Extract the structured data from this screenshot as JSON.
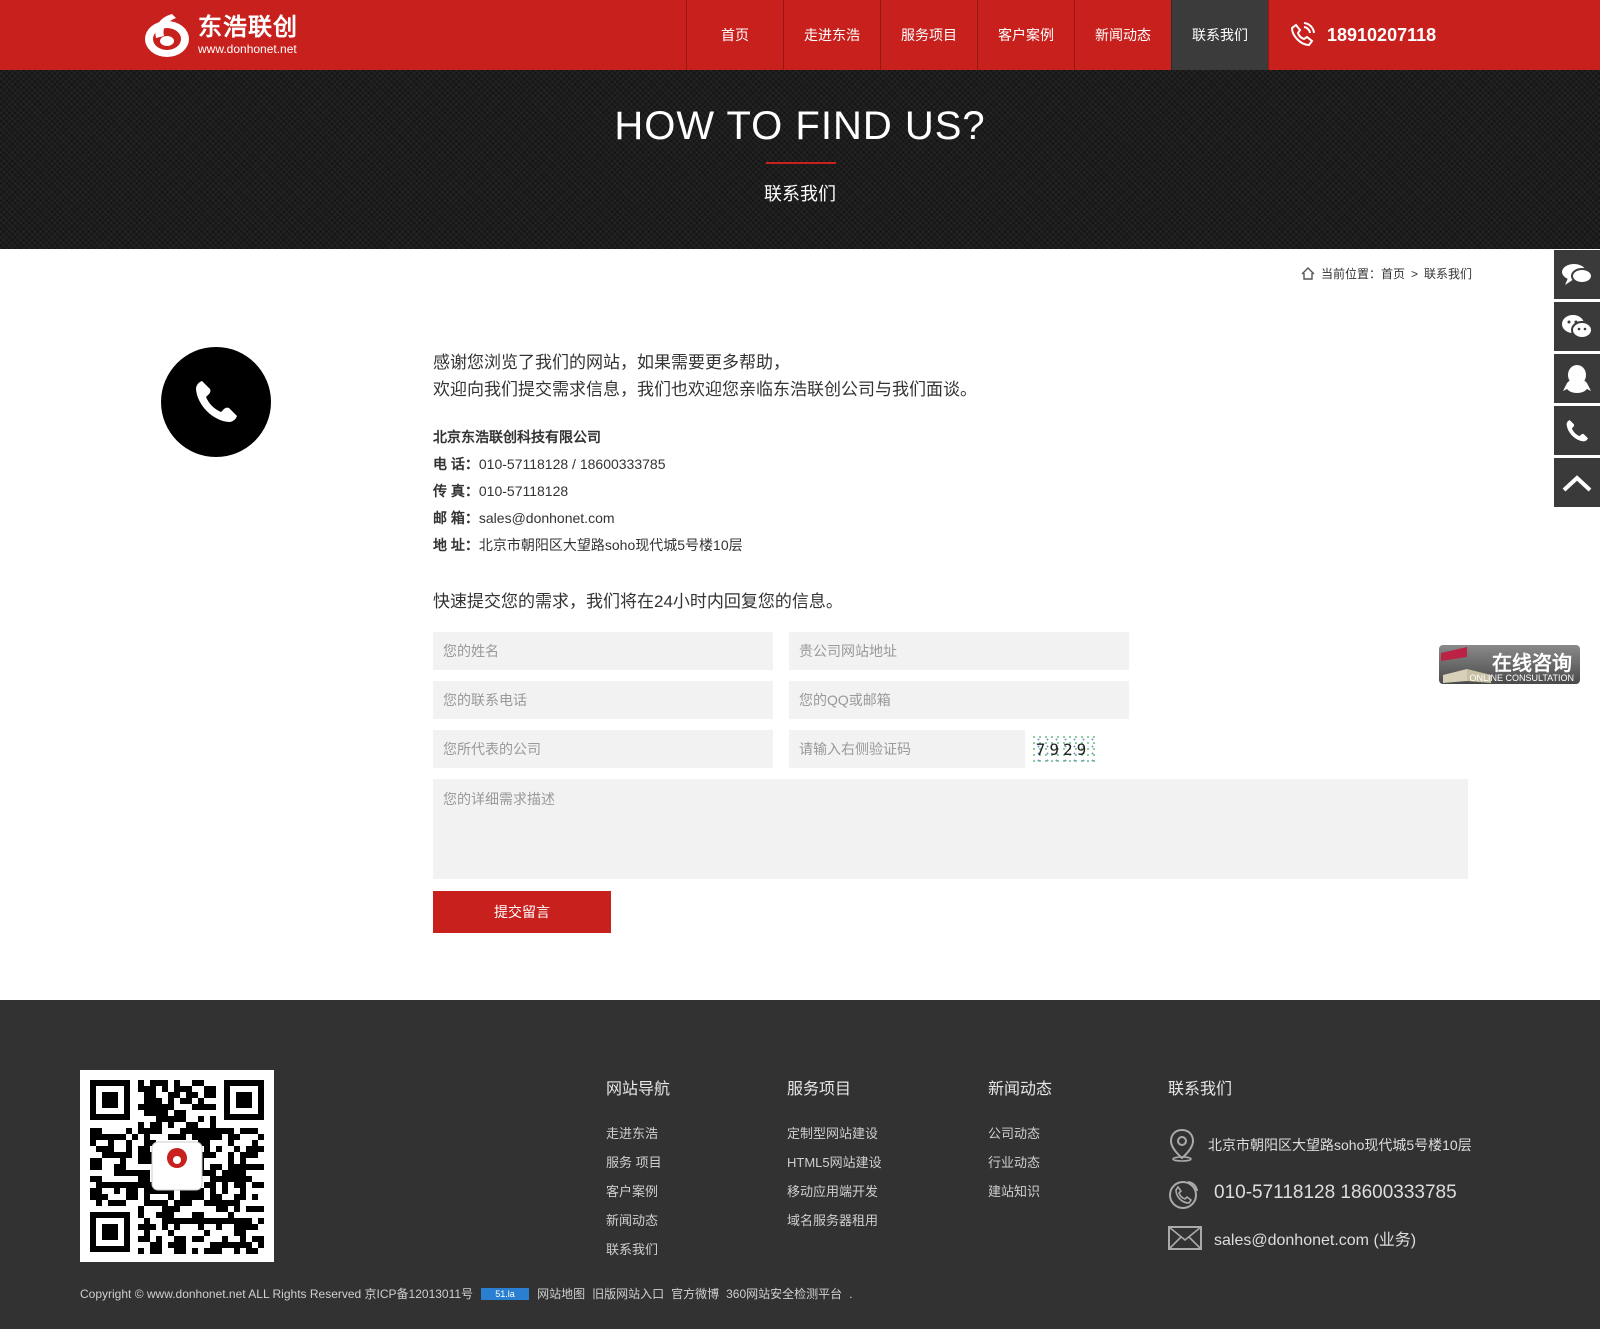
{
  "header": {
    "logo_cn": "东浩联创",
    "logo_url": "www.donhonet.net",
    "nav": [
      "首页",
      "走进东浩",
      "服务项目",
      "客户案例",
      "新闻动态",
      "联系我们"
    ],
    "active_nav": "联系我们",
    "phone": "18910207118"
  },
  "banner": {
    "title": "HOW TO FIND US?",
    "subtitle": "联系我们"
  },
  "breadcrumb": {
    "label": "当前位置：",
    "home": "首页",
    "separator": ">",
    "current": "联系我们"
  },
  "intro": {
    "line1": "感谢您浏览了我们的网站，如果需要更多帮助，",
    "line2": "欢迎向我们提交需求信息，我们也欢迎您亲临东浩联创公司与我们面谈。"
  },
  "company": {
    "name": "北京东浩联创科技有限公司",
    "tel_label": "电 话：",
    "tel": "010-57118128 / 18600333785",
    "fax_label": "传 真：",
    "fax": "010-57118128",
    "email_label": "邮 箱：",
    "email": "sales@donhonet.com",
    "addr_label": "地 址：",
    "addr": "北京市朝阳区大望路soho现代城5号楼10层"
  },
  "form": {
    "heading": "快速提交您的需求，我们将在24小时内回复您的信息。",
    "name_ph": "您的姓名",
    "site_ph": "贵公司网站地址",
    "phone_ph": "您的联系电话",
    "qq_ph": "您的QQ或邮箱",
    "company_ph": "您所代表的公司",
    "captcha_ph": "请输入右侧验证码",
    "captcha": "7929",
    "desc_ph": "您的详细需求描述",
    "submit": "提交留言"
  },
  "float": {
    "consult_cn": "在线咨询",
    "consult_en": "ONLINE CONSULTATION"
  },
  "footer": {
    "nav_title": "网站导航",
    "nav_links": [
      "走进东浩",
      "服务 项目",
      "客户案例",
      "新闻动态",
      "联系我们"
    ],
    "service_title": "服务项目",
    "service_links": [
      "定制型网站建设",
      "HTML5网站建设",
      "移动应用端开发",
      "域名服务器租用"
    ],
    "news_title": "新闻动态",
    "news_links": [
      "公司动态",
      "行业动态",
      "建站知识"
    ],
    "contact_title": "联系我们",
    "address": "北京市朝阳区大望路soho现代城5号楼10层",
    "phones": "010-57118128 18600333785",
    "email": "sales@donhonet.com (业务)",
    "copyright": "Copyright © www.donhonet.net ALL Rights Reserved 京ICP备12013011号",
    "badge": "51.la",
    "bottom_links": [
      "网站地图",
      "旧版网站入口",
      "官方微博",
      "360网站安全检测平台"
    ],
    "trailing": "."
  },
  "colors": {
    "brand_red": "#c8201d",
    "dark": "#323232",
    "field_bg": "#f2f2f2"
  }
}
